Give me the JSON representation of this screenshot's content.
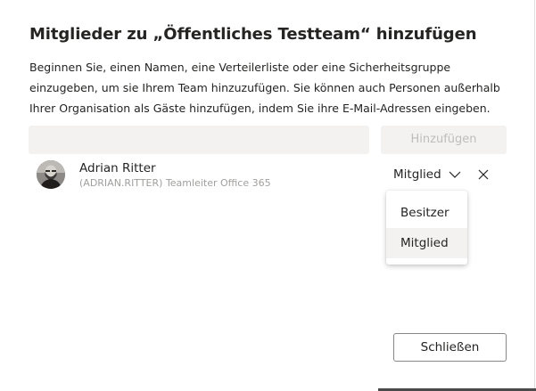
{
  "dialog": {
    "title": "Mitglieder zu „Öffentliches Testteam“ hinzufügen",
    "description": "Beginnen Sie, einen Namen, eine Verteilerliste oder eine Sicherheitsgruppe einzugeben, um sie Ihrem Team hinzuzufügen. Sie können auch Personen außerhalb Ihrer Organisation als Gäste hinzufügen, indem Sie ihre E-Mail-Adressen eingeben.",
    "search_value": "",
    "add_label": "Hinzufügen",
    "close_label": "Schließen"
  },
  "member": {
    "name": "Adrian Ritter",
    "subtitle": "(ADRIAN.RITTER) Teamleiter Office 365",
    "role": "Mitglied",
    "icons": {
      "avatar": "user-photo",
      "dropdown": "chevron-down-icon",
      "remove": "close-icon"
    }
  },
  "role_menu": {
    "items": [
      {
        "label": "Besitzer",
        "selected": false
      },
      {
        "label": "Mitglied",
        "selected": true
      }
    ]
  },
  "colors": {
    "input_bg": "#f3f2f1",
    "disabled_text": "#bdbdbd",
    "text": "#252423",
    "secondary_text": "#a19f9d",
    "border": "#8a8886"
  }
}
